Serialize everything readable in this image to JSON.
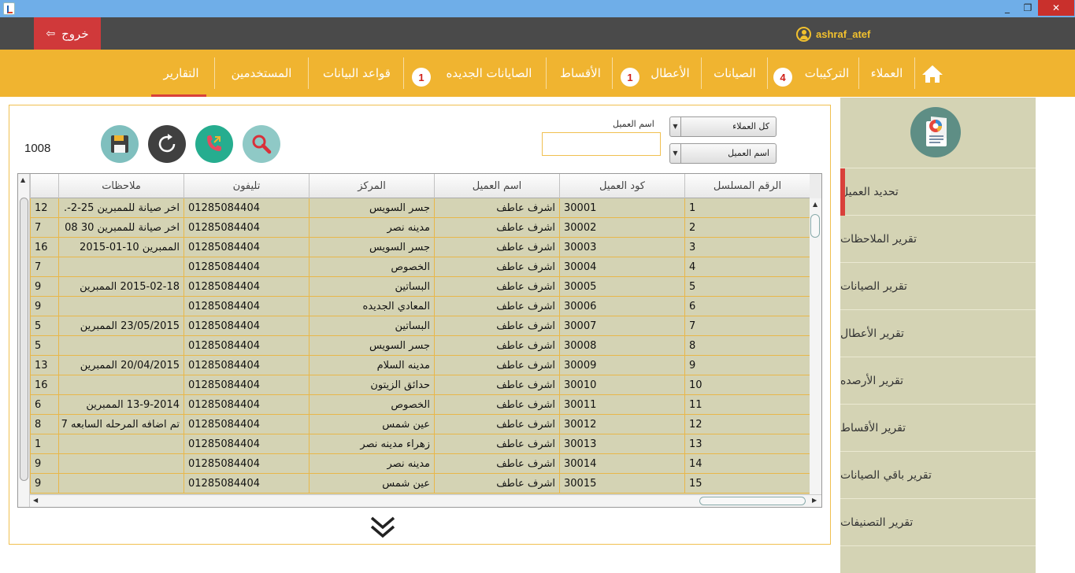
{
  "window": {
    "min": "_",
    "max": "❐",
    "close": "✕"
  },
  "header": {
    "logout_label": "خروج",
    "username": "ashraf_atef"
  },
  "nav": {
    "customers": "العملاء",
    "installations": "التركيبات",
    "installations_badge": "4",
    "maintenance": "الصيانات",
    "faults": "الأعطال",
    "faults_badge": "1",
    "installments": "الأقساط",
    "new_maintenance": "الصايانات الجديده",
    "new_maintenance_badge": "1",
    "databases": "قواعد البيانات",
    "users": "المستخدمين",
    "reports": "التقارير"
  },
  "sidebar": {
    "items": [
      "تحديد العميل",
      "تقرير الملاحظات",
      "تقرير الصيانات",
      "تقرير الأعطال",
      "تقرير الأرصده",
      "تقرير الأقساط",
      "تقرير باقي الصيانات",
      "تقرير التصنيفات"
    ]
  },
  "filters": {
    "customer_name_label": "اسم العميل",
    "customer_name_value": "",
    "scope_select": "كل العملاء",
    "field_select": "اسم العميل"
  },
  "record_count": "1008",
  "table": {
    "columns": [
      "الرقم المسلسل",
      "كود العميل",
      "اسم العميل",
      "المركز",
      "تليفون",
      "ملاحظات",
      ""
    ],
    "rows": [
      [
        "1",
        "30001",
        "اشرف عاطف",
        "جسر السويس",
        "01285084404",
        "اخر صيانة  للممبرين 25-2-.",
        "12"
      ],
      [
        "2",
        "30002",
        "اشرف عاطف",
        "مدينه نصر",
        "01285084404",
        "اخر صيانة  للممبرين 30 08",
        "7"
      ],
      [
        "3",
        "30003",
        "اشرف عاطف",
        "جسر السويس",
        "01285084404",
        "الممبرين 10-01-2015",
        "16"
      ],
      [
        "4",
        "30004",
        "اشرف عاطف",
        "الخصوص",
        "01285084404",
        "",
        "7"
      ],
      [
        "5",
        "30005",
        "اشرف عاطف",
        "البساتين",
        "01285084404",
        "2015-02-18 الممبرين",
        "9"
      ],
      [
        "6",
        "30006",
        "اشرف عاطف",
        "المعادي الجديده",
        "01285084404",
        "",
        "9"
      ],
      [
        "7",
        "30007",
        "اشرف عاطف",
        "البساتين",
        "01285084404",
        "23/05/2015 الممبرين",
        "5"
      ],
      [
        "8",
        "30008",
        "اشرف عاطف",
        "جسر السويس",
        "01285084404",
        "",
        "5"
      ],
      [
        "9",
        "30009",
        "اشرف عاطف",
        "مدينه السلام",
        "01285084404",
        "20/04/2015 الممبرين",
        "13"
      ],
      [
        "10",
        "30010",
        "اشرف عاطف",
        "حدائق الزيتون",
        "01285084404",
        "",
        "16"
      ],
      [
        "11",
        "30011",
        "اشرف عاطف",
        "الخصوص",
        "01285084404",
        "13-9-2014 الممبرين",
        "6"
      ],
      [
        "12",
        "30012",
        "اشرف عاطف",
        "عين شمس",
        "01285084404",
        "تم اضافه المرحله السابعه 7",
        "8"
      ],
      [
        "13",
        "30013",
        "اشرف عاطف",
        "زهراء مدينه نصر",
        "01285084404",
        "",
        "1"
      ],
      [
        "14",
        "30014",
        "اشرف عاطف",
        "مدينه نصر",
        "01285084404",
        "",
        "9"
      ],
      [
        "15",
        "30015",
        "اشرف عاطف",
        "عين شمس",
        "01285084404",
        "",
        "9"
      ]
    ]
  },
  "colors": {
    "nav": "#f0b430",
    "accent_red": "#d9403a",
    "sidebar": "#d4d3b4",
    "topbar": "#4a4a4a"
  },
  "icons": [
    "home-icon",
    "user-icon",
    "logout-icon",
    "save-icon",
    "refresh-icon",
    "phone-icon",
    "search-icon",
    "report-icon",
    "chevron-double-down-icon"
  ]
}
